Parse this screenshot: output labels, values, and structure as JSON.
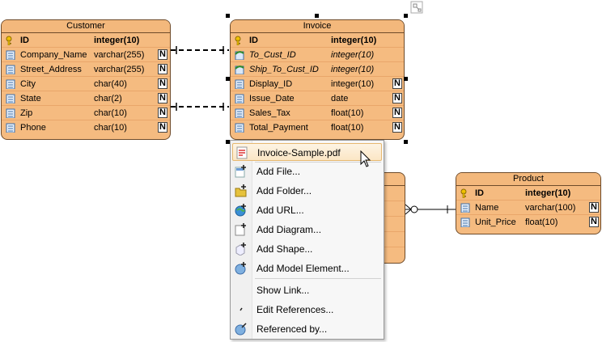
{
  "customer": {
    "title": "Customer",
    "columns": [
      {
        "name": "ID",
        "type": "integer(10)",
        "kind": "pk",
        "nullable": ""
      },
      {
        "name": "Company_Name",
        "type": "varchar(255)",
        "kind": "col",
        "nullable": "N"
      },
      {
        "name": "Street_Address",
        "type": "varchar(255)",
        "kind": "col",
        "nullable": "N"
      },
      {
        "name": "City",
        "type": "char(40)",
        "kind": "col",
        "nullable": "N"
      },
      {
        "name": "State",
        "type": "char(2)",
        "kind": "col",
        "nullable": "N"
      },
      {
        "name": "Zip",
        "type": "char(10)",
        "kind": "col",
        "nullable": "N"
      },
      {
        "name": "Phone",
        "type": "char(10)",
        "kind": "col",
        "nullable": "N"
      }
    ]
  },
  "invoice": {
    "title": "Invoice",
    "columns": [
      {
        "name": "ID",
        "type": "integer(10)",
        "kind": "pk",
        "nullable": ""
      },
      {
        "name": "To_Cust_ID",
        "type": "integer(10)",
        "kind": "fk",
        "nullable": ""
      },
      {
        "name": "Ship_To_Cust_ID",
        "type": "integer(10)",
        "kind": "fk",
        "nullable": ""
      },
      {
        "name": "Display_ID",
        "type": "integer(10)",
        "kind": "col",
        "nullable": "N"
      },
      {
        "name": "Issue_Date",
        "type": "date",
        "kind": "col",
        "nullable": "N"
      },
      {
        "name": "Sales_Tax",
        "type": "float(10)",
        "kind": "col",
        "nullable": "N"
      },
      {
        "name": "Total_Payment",
        "type": "float(10)",
        "kind": "col",
        "nullable": "N"
      }
    ]
  },
  "product": {
    "title": "Product",
    "columns": [
      {
        "name": "ID",
        "type": "integer(10)",
        "kind": "pk",
        "nullable": ""
      },
      {
        "name": "Name",
        "type": "varchar(100)",
        "kind": "col",
        "nullable": "N"
      },
      {
        "name": "Unit_Price",
        "type": "float(10)",
        "kind": "col",
        "nullable": "N"
      }
    ]
  },
  "menu": {
    "items": [
      {
        "label": "Invoice-Sample.pdf",
        "icon": "pdf-icon"
      },
      {
        "label": "Add File...",
        "icon": "add-file-icon"
      },
      {
        "label": "Add Folder...",
        "icon": "add-folder-icon"
      },
      {
        "label": "Add URL...",
        "icon": "add-url-icon"
      },
      {
        "label": "Add Diagram...",
        "icon": "add-diagram-icon"
      },
      {
        "label": "Add Shape...",
        "icon": "add-shape-icon"
      },
      {
        "label": "Add Model Element...",
        "icon": "add-model-element-icon"
      },
      {
        "label": "Show Link...",
        "icon": ""
      },
      {
        "label": "Edit References...",
        "icon": "edit-references-icon"
      },
      {
        "label": "Referenced by...",
        "icon": "referenced-by-icon"
      }
    ]
  },
  "colors": {
    "entity_fill": "#f5bb80",
    "entity_border": "#6e4b2a",
    "menu_highlight": "#fbe6c5"
  }
}
